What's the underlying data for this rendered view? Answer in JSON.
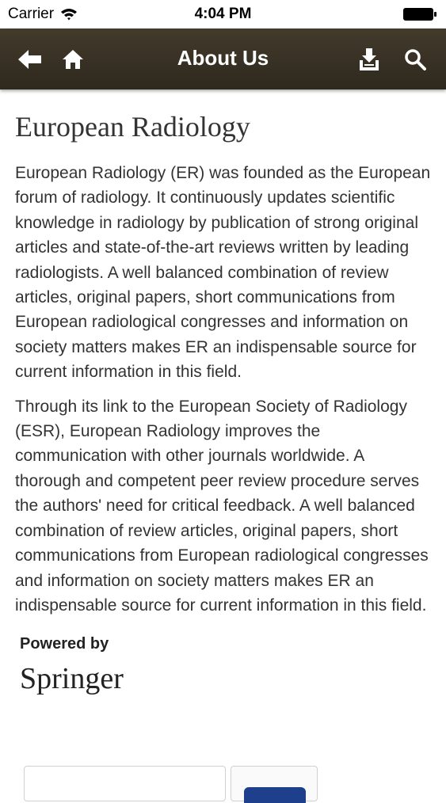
{
  "status_bar": {
    "carrier": "Carrier",
    "time": "4:04 PM"
  },
  "nav": {
    "title": "About Us",
    "icons": [
      "back-arrow-icon",
      "home-icon",
      "download-icon",
      "search-icon"
    ],
    "background": "#3a3326"
  },
  "article": {
    "title": "European Radiology",
    "paragraphs": [
      "European Radiology (ER) was founded as the European forum of radiology. It continuously updates scientific knowledge in radiology by publication of strong original articles and state-of-the-art reviews written by leading radiologists. A well balanced combination of review articles, original papers, short communications from European radiological congresses and information on society matters makes ER an indispensable source for current information in this field.",
      "Through its link to the European Society of Radiology (ESR), European Radiology improves the communication with other journals worldwide. A thorough and competent peer review procedure serves the authors' need for critical feedback. A well balanced combination of review articles, original papers, short communications from European radiological congresses and information on society matters makes ER an indispensable source for current information in this field."
    ]
  },
  "footer": {
    "powered_by": "Powered by",
    "brand": "Springer"
  }
}
